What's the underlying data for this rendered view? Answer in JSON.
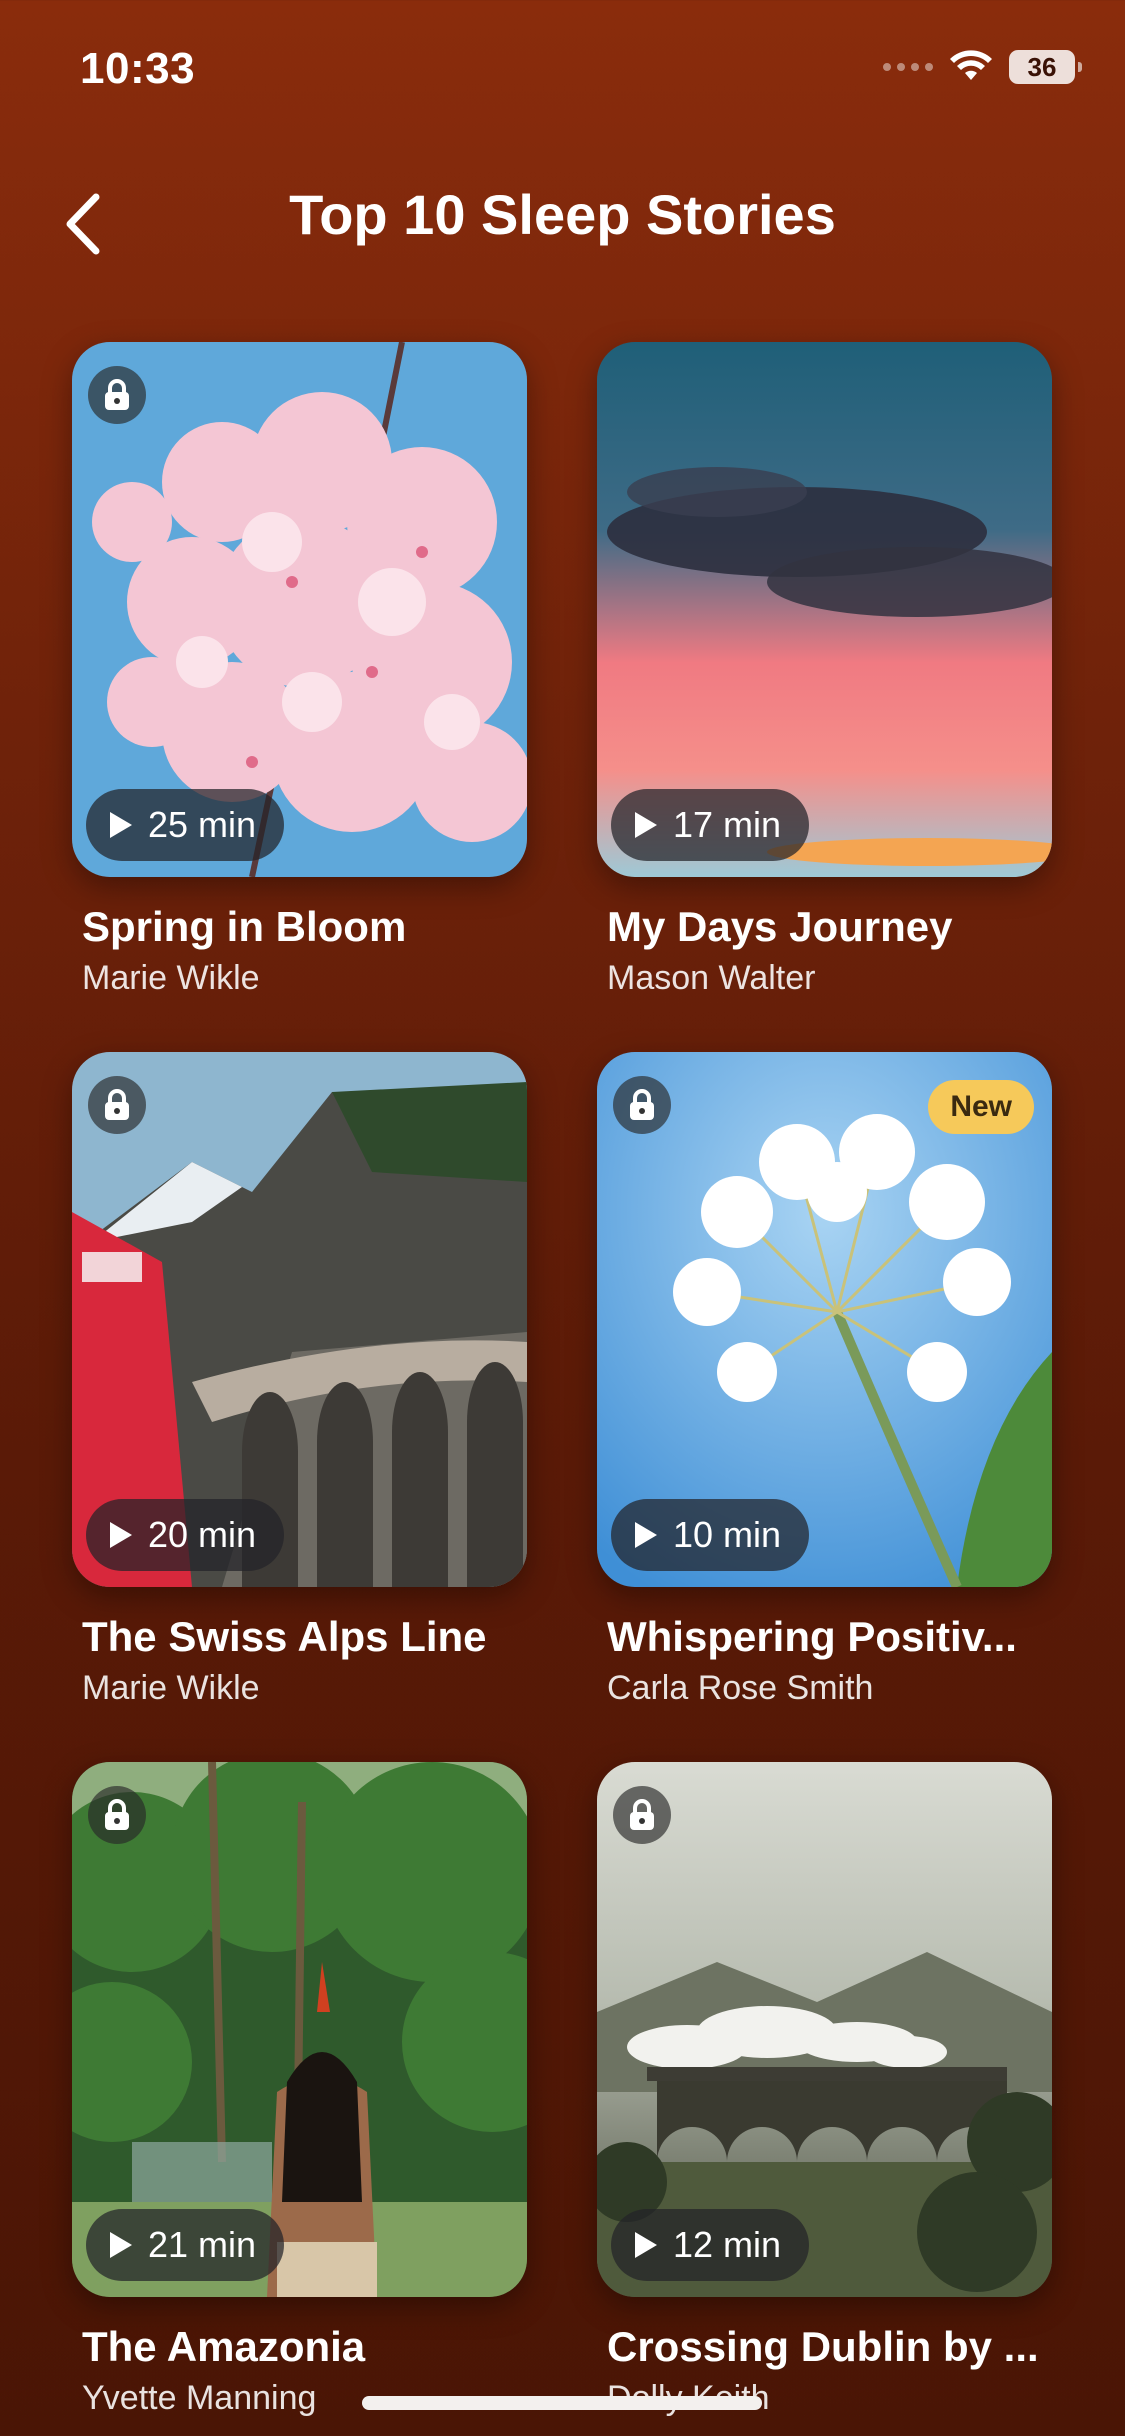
{
  "status_bar": {
    "time": "10:33",
    "battery": "36"
  },
  "header": {
    "title": "Top 10 Sleep Stories"
  },
  "stories": [
    {
      "title": "Spring in Bloom",
      "author": "Marie Wikle",
      "duration": "25 min",
      "locked": true,
      "badge": "",
      "scene": "cherry-blossom"
    },
    {
      "title": "My Days Journey",
      "author": "Mason Walter",
      "duration": "17 min",
      "locked": false,
      "badge": "",
      "scene": "sunset-sky"
    },
    {
      "title": "The Swiss Alps Line",
      "author": "Marie Wikle",
      "duration": "20 min",
      "locked": true,
      "badge": "",
      "scene": "alpine-viaduct"
    },
    {
      "title": "Whispering Positiv...",
      "author": "Carla Rose Smith",
      "duration": "10 min",
      "locked": true,
      "badge": "New",
      "scene": "dandelion-flower"
    },
    {
      "title": "The Amazonia",
      "author": "Yvette Manning",
      "duration": "21 min",
      "locked": true,
      "badge": "",
      "scene": "rainforest"
    },
    {
      "title": "Crossing Dublin by ...",
      "author": "Dolly Keith",
      "duration": "12 min",
      "locked": true,
      "badge": "",
      "scene": "steam-train-viaduct"
    }
  ],
  "colors": {
    "background_top": "#8a2c0c",
    "background_bottom": "#4a1505",
    "new_badge": "#f6c95a"
  }
}
